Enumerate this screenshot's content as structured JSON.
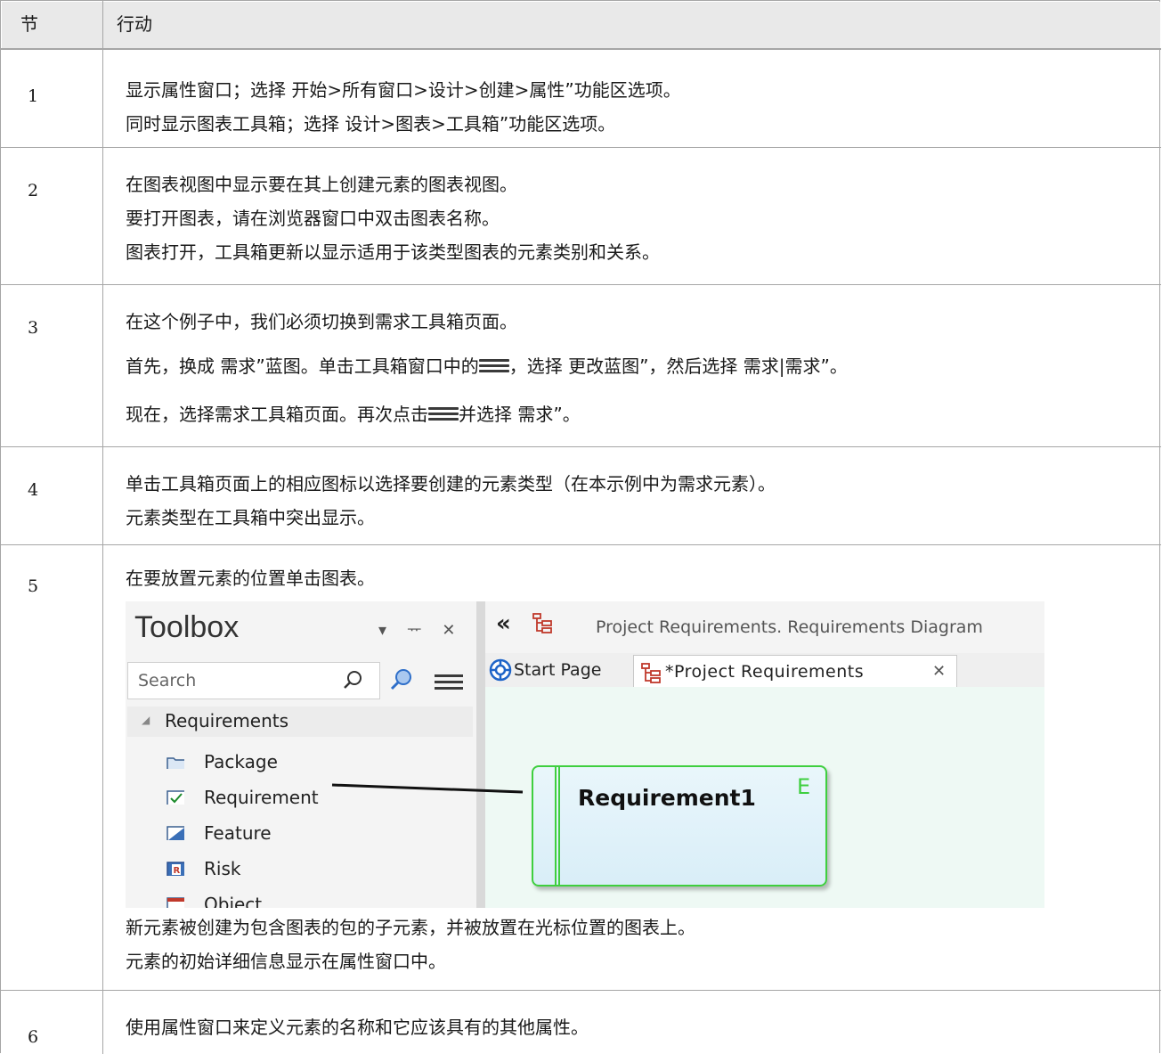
{
  "header": {
    "col_step": "节",
    "col_action": "行动"
  },
  "rows": [
    {
      "num": "1",
      "lines": [
        "显示属性窗口；选择 开始>所有窗口>设计>创建>属性”功能区选项。",
        "同时显示图表工具箱；选择 设计>图表>工具箱”功能区选项。"
      ]
    },
    {
      "num": "2",
      "lines": [
        "在图表视图中显示要在其上创建元素的图表视图。",
        "要打开图表，请在浏览器窗口中双击图表名称。",
        "图表打开，工具箱更新以显示适用于该类型图表的元素类别和关系。"
      ]
    },
    {
      "num": "3",
      "line1": "在这个例子中，我们必须切换到需求工具箱页面。",
      "line2a": "首先，换成 需求”蓝图。单击工具箱窗口中的",
      "line2b": "，选择 更改蓝图”，然后选择 需求|需求”。",
      "line3a": "现在，选择需求工具箱页面。再次点击",
      "line3b": "并选择 需求”。"
    },
    {
      "num": "4",
      "lines": [
        "单击工具箱页面上的相应图标以选择要创建的元素类型（在本示例中为需求元素）。",
        "元素类型在工具箱中突出显示。"
      ]
    },
    {
      "num": "5",
      "line_top": "在要放置元素的位置单击图表。",
      "lines_after": [
        "新元素被创建为包含图表的包的子元素，并被放置在光标位置的图表上。",
        "元素的初始详细信息显示在属性窗口中。"
      ]
    },
    {
      "num": "6",
      "lines": [
        "使用属性窗口来定义元素的名称和它应该具有的其他属性。"
      ]
    }
  ],
  "screenshot": {
    "toolbox_title": "Toolbox",
    "pin_icon_glyph": "ᅲ",
    "search_placeholder": "Search",
    "group": "Requirements",
    "items": [
      "Package",
      "Requirement",
      "Feature",
      "Risk",
      "Object"
    ],
    "breadcrumb": "Project Requirements.  Requirements Diagram",
    "tab_start": "Start Page",
    "tab_project": "*Project Requirements",
    "element_name": "Requirement1",
    "element_badge": "E",
    "glyph_collapse": "▾",
    "glyph_close": "✕",
    "glyph_double_left": "«",
    "glyph_triangle": "◢",
    "colors": {
      "element_border": "#3fcf3f",
      "element_fill": "#dcf0f9",
      "canvas": "#eef9f4",
      "tab_icon": "#c0392b",
      "start_icon": "#1e64c8"
    }
  }
}
